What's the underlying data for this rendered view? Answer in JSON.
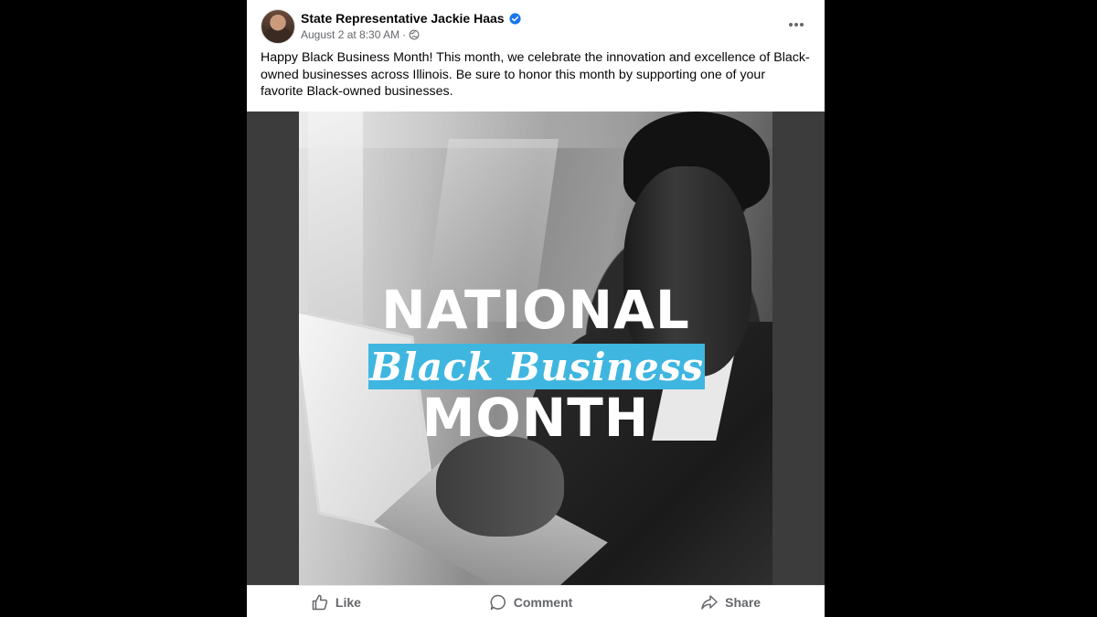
{
  "post": {
    "author": "State Representative Jackie Haas",
    "timestamp": "August 2 at 8:30 AM",
    "separator": "·",
    "caption": "Happy Black Business Month! This month, we celebrate the innovation and excellence of Black-owned businesses across Illinois. Be sure to honor this month by supporting one of your favorite Black-owned businesses.",
    "image": {
      "line1": "NATIONAL",
      "line2": "Black Business",
      "line3": "MONTH",
      "accent_color": "#3fb6e0"
    }
  },
  "actions": {
    "like": "Like",
    "comment": "Comment",
    "share": "Share"
  },
  "icons": {
    "verified": "verified-badge-icon",
    "privacy": "globe-icon",
    "more": "more-options-icon",
    "like": "thumbs-up-icon",
    "comment": "comment-bubble-icon",
    "share": "share-arrow-icon"
  },
  "colors": {
    "verified": "#1877f2",
    "secondary_text": "#65676b"
  }
}
